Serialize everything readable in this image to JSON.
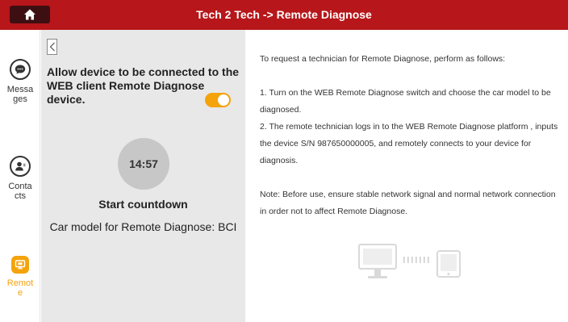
{
  "header": {
    "title": "Tech 2 Tech -> Remote Diagnose",
    "home_icon": "home-icon"
  },
  "sidebar": {
    "items": [
      {
        "label": "Messa\nges",
        "icon": "chat-icon",
        "active": false
      },
      {
        "label": "Conta\ncts",
        "icon": "contact-icon",
        "active": false
      },
      {
        "label": "Remot\ne",
        "icon": "remote-icon",
        "active": true
      }
    ]
  },
  "left_panel": {
    "back_icon": "chevron-left-icon",
    "allow_text": "Allow device to be connected to the WEB client Remote Diagnose device.",
    "toggle_on": true,
    "countdown": "14:57",
    "start_label": "Start countdown",
    "model_label": "Car model for Remote Diagnose: BCI"
  },
  "right_panel": {
    "intro": "To request a technician for Remote Diagnose, perform as follows:",
    "step1": "1. Turn on the WEB Remote Diagnose switch and choose the car model to be diagnosed.",
    "step2": "2. The remote technician logs in to the WEB Remote Diagnose platform , inputs the device S/N 987650000005, and remotely connects to your device for diagnosis.",
    "note": "Note: Before use, ensure stable network signal and normal network connection in order not to affect Remote Diagnose.",
    "illustration": "computer-to-tablet-connection-icon"
  },
  "colors": {
    "header_bg": "#b7161a",
    "accent": "#f4a30b",
    "panel_bg": "#e8e8e8"
  }
}
